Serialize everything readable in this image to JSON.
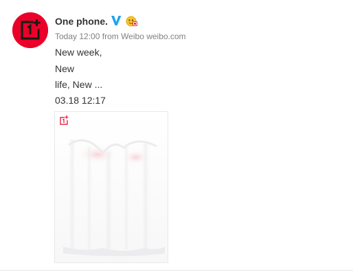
{
  "post": {
    "author": {
      "name": "One phone.",
      "avatar_icon": "oneplus-logo-icon",
      "avatar_color": "#eb0029",
      "verified_icon": "verified-v-icon",
      "verified_color": "#1da1f2",
      "badge_icon": "vip-badge-icon"
    },
    "meta": {
      "time": "Today 12:00",
      "source": "from Weibo weibo.com"
    },
    "text_lines": [
      "New week,",
      "New",
      "life, New ...",
      "03.18 12:17"
    ],
    "media": {
      "watermark_icon": "oneplus-watermark-icon",
      "description_icon": "white-curtain-image"
    }
  }
}
